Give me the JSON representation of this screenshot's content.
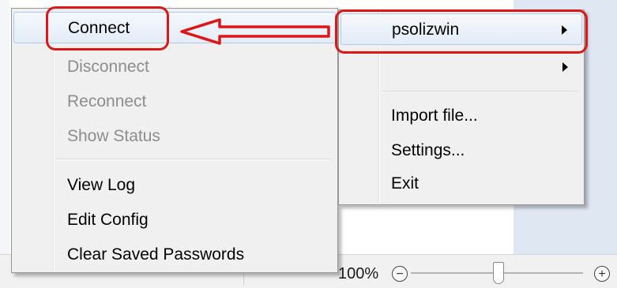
{
  "colors": {
    "menu_bg": "#f0f0f0",
    "highlight_border": "#aecbeb",
    "disabled_text": "#8d8d8d",
    "annotation_red": "#e01515"
  },
  "left_menu": {
    "items": [
      {
        "label": "Connect",
        "state": "highlighted"
      },
      {
        "label": "Disconnect",
        "state": "disabled"
      },
      {
        "label": "Reconnect",
        "state": "disabled"
      },
      {
        "label": "Show Status",
        "state": "disabled"
      },
      {
        "label": "View Log",
        "state": "enabled"
      },
      {
        "label": "Edit Config",
        "state": "enabled"
      },
      {
        "label": "Clear Saved Passwords",
        "state": "enabled"
      }
    ]
  },
  "right_menu": {
    "items": [
      {
        "label": "psolizwin",
        "has_submenu": true,
        "state": "highlighted"
      },
      {
        "label": "",
        "has_submenu": true,
        "state": "enabled"
      },
      {
        "label": "Import file...",
        "has_submenu": false,
        "state": "enabled"
      },
      {
        "label": "Settings...",
        "has_submenu": false,
        "state": "enabled"
      },
      {
        "label": "Exit",
        "has_submenu": false,
        "state": "enabled"
      }
    ]
  },
  "statusbar": {
    "zoom_level": "100%",
    "zoom_out_icon": "minus-circle-icon",
    "zoom_in_icon": "plus-circle-icon",
    "zoom_slider_fraction": 0.5
  },
  "annotations": {
    "arrow_icon": "left-arrow-icon",
    "highlight_targets": [
      "Connect",
      "psolizwin"
    ]
  }
}
